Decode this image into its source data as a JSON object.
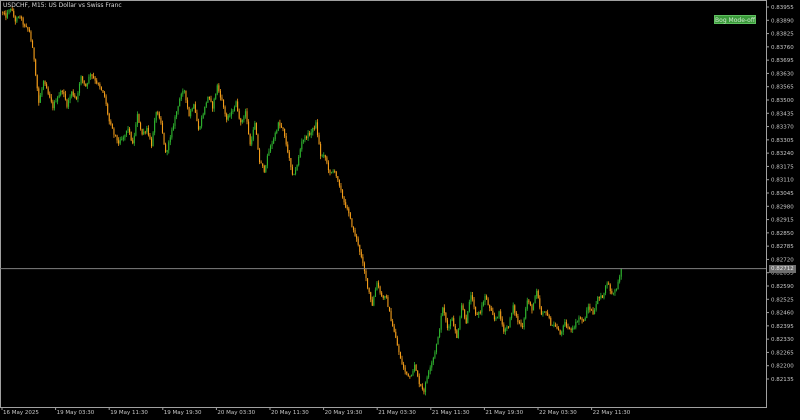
{
  "header": {
    "symbol_info": "USDCHF, M15:  US Dollar vs Swiss Franc",
    "indicator_badge": "Bog Mode-off"
  },
  "colors": {
    "background": "#000000",
    "axis": "#a0a0a0",
    "bull": "#2fb52f",
    "bear": "#f59e1a",
    "price_line": "#808080",
    "price_tag": "#6e6e6e"
  },
  "price_axis": {
    "labels": [
      "0.83955",
      "0.83890",
      "0.83825",
      "0.83760",
      "0.83695",
      "0.83630",
      "0.83565",
      "0.83500",
      "0.83435",
      "0.83370",
      "0.83305",
      "0.83240",
      "0.83175",
      "0.83110",
      "0.83045",
      "0.82980",
      "0.82915",
      "0.82850",
      "0.82785",
      "0.82720",
      "0.82655",
      "0.82590",
      "0.82525",
      "0.82460",
      "0.82395",
      "0.82330",
      "0.82265",
      "0.82200",
      "0.82135"
    ],
    "current_price": "0.82712"
  },
  "time_axis": {
    "labels": [
      "16 May 2025",
      "19 May 03:30",
      "19 May 11:30",
      "19 May 19:30",
      "20 May 03:30",
      "20 May 11:30",
      "20 May 19:30",
      "21 May 03:30",
      "21 May 11:30",
      "21 May 19:30",
      "22 May 03:30",
      "22 May 11:30"
    ]
  },
  "chart_data": {
    "type": "line",
    "title": "",
    "xlabel": "",
    "ylabel": "",
    "ylim": [
      0.82135,
      0.83955
    ],
    "current_price": 0.82712,
    "series": [
      {
        "values": [
          0.8393,
          0.8391,
          0.8395,
          0.8389,
          0.8391,
          0.8386,
          0.8384,
          0.8371,
          0.835,
          0.836,
          0.8354,
          0.8348,
          0.8353,
          0.8356,
          0.8349,
          0.8355,
          0.8352,
          0.8362,
          0.8358,
          0.8364,
          0.8361,
          0.8357,
          0.8353,
          0.8341,
          0.8335,
          0.8331,
          0.8333,
          0.8338,
          0.833,
          0.8344,
          0.8335,
          0.8338,
          0.833,
          0.8346,
          0.834,
          0.8326,
          0.8333,
          0.8343,
          0.8352,
          0.8356,
          0.8344,
          0.835,
          0.8337,
          0.8345,
          0.8353,
          0.8348,
          0.8358,
          0.8351,
          0.8342,
          0.8345,
          0.835,
          0.834,
          0.8346,
          0.833,
          0.834,
          0.8322,
          0.8318,
          0.8327,
          0.8333,
          0.834,
          0.8337,
          0.8327,
          0.8315,
          0.832,
          0.8332,
          0.8334,
          0.8336,
          0.834,
          0.8325,
          0.8324,
          0.8316,
          0.8318,
          0.831,
          0.8303,
          0.8297,
          0.8289,
          0.8283,
          0.8273,
          0.8263,
          0.8254,
          0.8265,
          0.8258,
          0.8257,
          0.8247,
          0.8238,
          0.8228,
          0.8222,
          0.822,
          0.8225,
          0.8217,
          0.8213,
          0.8223,
          0.8229,
          0.8238,
          0.8253,
          0.8243,
          0.8248,
          0.8238,
          0.8254,
          0.8246,
          0.8259,
          0.8249,
          0.8251,
          0.8258,
          0.8252,
          0.8247,
          0.825,
          0.8242,
          0.8244,
          0.8253,
          0.8246,
          0.8244,
          0.8256,
          0.8252,
          0.826,
          0.8249,
          0.8251,
          0.8245,
          0.8244,
          0.824,
          0.8245,
          0.8242,
          0.8244,
          0.8248,
          0.8246,
          0.8253,
          0.825,
          0.8257,
          0.8258,
          0.8265,
          0.8259,
          0.8262,
          0.8271
        ]
      }
    ]
  }
}
